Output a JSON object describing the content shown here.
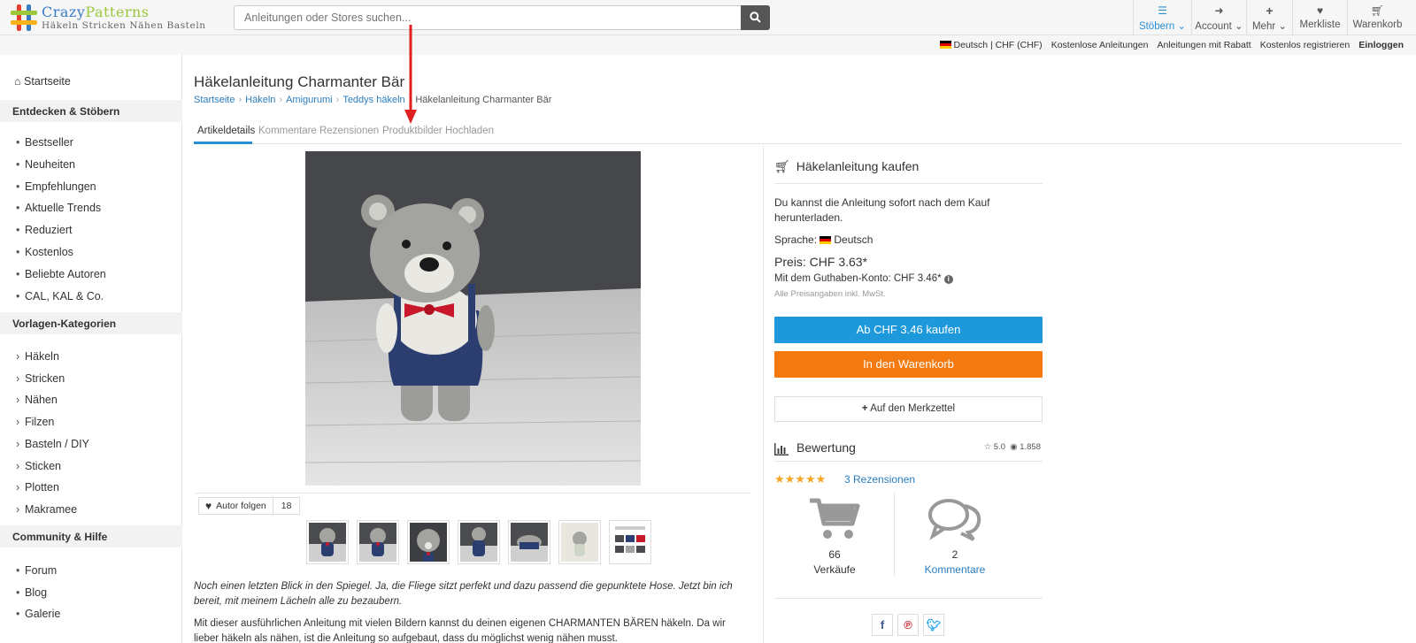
{
  "header": {
    "brand_part1": "Crazy",
    "brand_part2": "Patterns",
    "tagline": "Häkeln Stricken Nähen Basteln",
    "search_placeholder": "Anleitungen oder Stores suchen...",
    "nav": [
      {
        "label": "Stöbern",
        "icon": "menu-icon"
      },
      {
        "label": "Account",
        "icon": "sign-in-icon"
      },
      {
        "label": "Mehr",
        "icon": "plus-icon"
      },
      {
        "label": "Merkliste",
        "icon": "heart-icon"
      },
      {
        "label": "Warenkorb",
        "icon": "cart-icon"
      }
    ]
  },
  "subbar": {
    "language": "Deutsch | CHF (CHF)",
    "free": "Kostenlose Anleitungen",
    "discount": "Anleitungen mit Rabatt",
    "register": "Kostenlos registrieren",
    "login": "Einloggen"
  },
  "sidebar": {
    "home": "Startseite",
    "section1": "Entdecken & Stöbern",
    "discover": [
      "Bestseller",
      "Neuheiten",
      "Empfehlungen",
      "Aktuelle Trends",
      "Reduziert",
      "Kostenlos",
      "Beliebte Autoren",
      "CAL, KAL & Co."
    ],
    "section2": "Vorlagen-Kategorien",
    "categories": [
      "Häkeln",
      "Stricken",
      "Nähen",
      "Filzen",
      "Basteln / DIY",
      "Sticken",
      "Plotten",
      "Makramee"
    ],
    "section3": "Community & Hilfe",
    "community": [
      "Forum",
      "Blog",
      "Galerie"
    ]
  },
  "main": {
    "title": "Häkelanleitung Charmanter Bär",
    "breadcrumb": [
      "Startseite",
      "Häkeln",
      "Amigurumi",
      "Teddys häkeln",
      "Häkelanleitung Charmanter Bär"
    ],
    "tabs": [
      "Artikeldetails",
      "Kommentare",
      "Rezensionen",
      "Produktbilder",
      "Hochladen"
    ],
    "follow_label": "Autor folgen",
    "follow_count": "18",
    "desc1": "Noch einen letzten Blick in den Spiegel. Ja, die Fliege sitzt perfekt und dazu passend die gepunktete Hose. Jetzt bin ich bereit, mit meinem Lächeln alle zu bezaubern.",
    "desc2": "Mit dieser ausführlichen Anleitung mit vielen Bildern kannst du deinen eigenen CHARMANTEN BÄREN häkeln. Da wir lieber häkeln als nähen, ist die Anleitung so aufgebaut, dass du möglichst wenig nähen musst."
  },
  "buy": {
    "title": "Häkelanleitung kaufen",
    "text": "Du kannst die Anleitung sofort nach dem Kauf herunterladen.",
    "language_label": "Sprache:",
    "language_value": "Deutsch",
    "price": "Preis: CHF 3.63*",
    "credit": "Mit dem Guthaben-Konto: CHF 3.46*",
    "vat": "Alle Preisangaben inkl. MwSt.",
    "buy_button": "Ab CHF 3.46 kaufen",
    "cart_button": "In den Warenkorb",
    "wishlist_button": "Auf den Merkzettel"
  },
  "rating": {
    "title": "Bewertung",
    "score": "5.0",
    "views": "1.858",
    "stars": "★★★★★",
    "reviews": "3 Rezensionen",
    "sales_count": "66",
    "sales_label": "Verkäufe",
    "comments_count": "2",
    "comments_label": "Kommentare"
  },
  "colors": {
    "accent": "#1c98db",
    "cart": "#f47a0f",
    "link": "#2a7dc0",
    "arrow": "#e02020"
  }
}
